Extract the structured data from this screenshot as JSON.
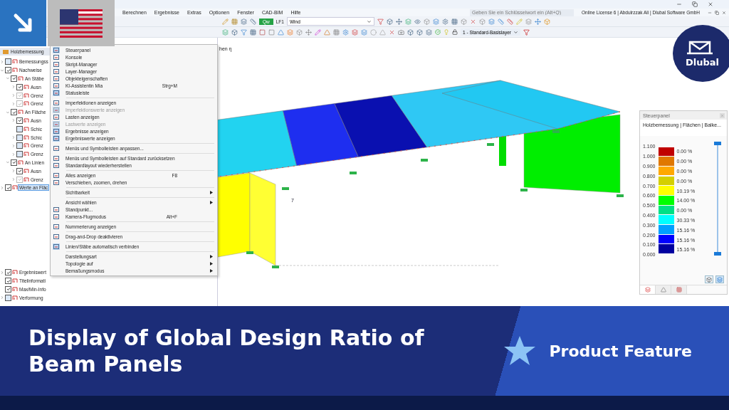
{
  "menu_bar": [
    "Berechnen",
    "Ergebnisse",
    "Extras",
    "Optionen",
    "Fenster",
    "CAD-BIM",
    "Hilfe"
  ],
  "search": {
    "placeholder": "Geben Sie ein Schlüsselwort ein (Alt+Q)"
  },
  "license": "Online License 6 | Abdulrzzak Ali | Dlubal Software GmbH",
  "toolbar": {
    "load_case_type": "Qw",
    "load_case": "LF1",
    "load_case_name": "Wind",
    "layer": "1 - Standard-Basislayer"
  },
  "navigator": {
    "title": "Holzbemessung",
    "items": [
      {
        "label": "Bemessungss",
        "checked": false,
        "selected": false,
        "disabled": false,
        "expanded": false
      },
      {
        "label": "Nachweise",
        "checked": true,
        "selected": false,
        "disabled": false,
        "expanded": true,
        "children": [
          {
            "label": "An Stäbe",
            "checked": true,
            "selected": false,
            "disabled": false,
            "expanded": true,
            "children": [
              {
                "label": "Ausn",
                "checked": true,
                "selected": false,
                "disabled": false,
                "expanded": false
              },
              {
                "label": "Grenz",
                "checked": true,
                "selected": false,
                "disabled": true,
                "expanded": false
              },
              {
                "label": "Grenz",
                "checked": true,
                "selected": false,
                "disabled": true,
                "expanded": false
              }
            ]
          },
          {
            "label": "An Fläche",
            "checked": true,
            "selected": false,
            "disabled": false,
            "expanded": true,
            "children": [
              {
                "label": "Ausn",
                "checked": true,
                "selected": false,
                "disabled": false,
                "expanded": false
              },
              {
                "label": "Schic",
                "checked": false,
                "selected": false,
                "disabled": false
              },
              {
                "label": "Schic",
                "checked": false,
                "selected": false,
                "disabled": false,
                "expanded": false
              },
              {
                "label": "Grenz",
                "checked": false,
                "selected": false,
                "disabled": false,
                "expanded": false
              },
              {
                "label": "Grenz",
                "checked": false,
                "selected": false,
                "disabled": false,
                "expanded": false
              }
            ]
          },
          {
            "label": "An Linien",
            "checked": true,
            "selected": false,
            "disabled": false,
            "expanded": true,
            "children": [
              {
                "label": "Ausn",
                "checked": true,
                "selected": false,
                "disabled": false,
                "expanded": false
              },
              {
                "label": "Grenz",
                "checked": true,
                "selected": false,
                "disabled": true,
                "expanded": false
              }
            ]
          }
        ]
      },
      {
        "label": "Werte an Fläc",
        "checked": true,
        "selected": true,
        "disabled": false,
        "expanded": false
      }
    ],
    "bottom_items": [
      {
        "label": "Ergebniswert",
        "checked": true,
        "selected": false,
        "disabled": false,
        "expanded": false
      },
      {
        "label": "Titelinformati",
        "checked": true,
        "selected": false,
        "disabled": false
      },
      {
        "label": "Max/Min-Info",
        "checked": true,
        "selected": false,
        "disabled": false
      },
      {
        "label": "Verformung",
        "checked": false,
        "selected": false,
        "disabled": false,
        "expanded": false
      }
    ]
  },
  "view_menu": [
    {
      "kind": "command",
      "label": "Steuerpanel",
      "checked": true,
      "disabled": false
    },
    {
      "kind": "command",
      "label": "Konsole",
      "checked": false,
      "disabled": false
    },
    {
      "kind": "command",
      "label": "Skript-Manager",
      "checked": false,
      "disabled": false
    },
    {
      "kind": "command",
      "label": "Layer-Manager",
      "checked": false,
      "disabled": false
    },
    {
      "kind": "command",
      "label": "Objekteigenschaften",
      "checked": false,
      "disabled": false
    },
    {
      "kind": "command",
      "label": "KI-Assistentin Mia",
      "shortcut": "Strg+M",
      "checked": false,
      "disabled": false
    },
    {
      "kind": "command",
      "label": "Statusleiste",
      "checked": true,
      "disabled": false
    },
    {
      "kind": "separator"
    },
    {
      "kind": "command",
      "label": "Imperfektionen anzeigen",
      "checked": false,
      "disabled": false
    },
    {
      "kind": "command",
      "label": "Imperfektionswerte anzeigen",
      "checked": true,
      "disabled": true
    },
    {
      "kind": "command",
      "label": "Lasten anzeigen",
      "checked": false,
      "disabled": false
    },
    {
      "kind": "command",
      "label": "Lastwerte anzeigen",
      "checked": true,
      "disabled": true
    },
    {
      "kind": "command",
      "label": "Ergebnisse anzeigen",
      "checked": true,
      "disabled": false
    },
    {
      "kind": "command",
      "label": "Ergebniswerte anzeigen",
      "checked": true,
      "disabled": false
    },
    {
      "kind": "separator"
    },
    {
      "kind": "command",
      "label": "Menüs und Symbolleisten anpassen...",
      "checked": false,
      "disabled": false
    },
    {
      "kind": "separator"
    },
    {
      "kind": "command",
      "label": "Menüs und Symbolleisten auf Standard zurücksetzen",
      "checked": false,
      "disabled": false
    },
    {
      "kind": "command",
      "label": "Standardlayout wiederherstellen",
      "checked": false,
      "disabled": false
    },
    {
      "kind": "separator"
    },
    {
      "kind": "command",
      "label": "Alles anzeigen",
      "shortcut": "F8",
      "checked": false,
      "disabled": false
    },
    {
      "kind": "command",
      "label": "Verschieben, zoomen, drehen",
      "checked": false,
      "disabled": false
    },
    {
      "kind": "separator"
    },
    {
      "kind": "submenu",
      "label": "Sichtbarkeit"
    },
    {
      "kind": "separator"
    },
    {
      "kind": "submenu",
      "label": "Ansicht wählen"
    },
    {
      "kind": "command",
      "label": "Standpunkt...",
      "checked": false,
      "disabled": false
    },
    {
      "kind": "command",
      "label": "Kamera-Flugmodus",
      "shortcut": "Alt+F",
      "checked": false,
      "disabled": false
    },
    {
      "kind": "separator"
    },
    {
      "kind": "command",
      "label": "Nummerierung anzeigen",
      "checked": false,
      "disabled": false
    },
    {
      "kind": "separator"
    },
    {
      "kind": "command",
      "label": "Drag-and-Drop deaktivieren",
      "checked": false,
      "disabled": false
    },
    {
      "kind": "separator"
    },
    {
      "kind": "command",
      "label": "Linien/Stäbe automatisch verbinden",
      "checked": true,
      "disabled": false
    },
    {
      "kind": "separator"
    },
    {
      "kind": "submenu",
      "label": "Darstellungsart"
    },
    {
      "kind": "submenu",
      "label": "Topologie auf"
    },
    {
      "kind": "submenu",
      "label": "Bemaßungsmodus"
    }
  ],
  "viewport": {
    "heading": "hen η",
    "node_label": "7"
  },
  "control_panel": {
    "title": "Steuerpanel",
    "subtitle": "Holzbemessung | Flächen | Balke...",
    "legend": [
      {
        "value": "1.100",
        "color": "#c00000",
        "percent": "0.00 %"
      },
      {
        "value": "1.000",
        "color": "#e07800",
        "percent": "0.00 %"
      },
      {
        "value": "0.900",
        "color": "#ffa800",
        "percent": "0.00 %"
      },
      {
        "value": "0.800",
        "color": "#d4cf00",
        "percent": "0.00 %"
      },
      {
        "value": "0.700",
        "color": "#ffff00",
        "percent": "10.19 %"
      },
      {
        "value": "0.600",
        "color": "#00ff00",
        "percent": "14.00 %"
      },
      {
        "value": "0.500",
        "color": "#00e085",
        "percent": "0.00 %"
      },
      {
        "value": "0.400",
        "color": "#00ffff",
        "percent": "30.33 %"
      },
      {
        "value": "0.300",
        "color": "#00a0ff",
        "percent": "15.16 %"
      },
      {
        "value": "0.200",
        "color": "#0000ff",
        "percent": "15.16 %"
      },
      {
        "value": "0.100",
        "color": "#0000a0",
        "percent": "15.16 %"
      }
    ],
    "last_value": "0.000",
    "range_slider": {
      "level": 1
    },
    "tabs": [
      {
        "selected": true
      },
      {
        "selected": false
      },
      {
        "selected": false
      }
    ]
  },
  "banner": {
    "title": "Display of Global Design Ratio of Beam Panels",
    "tag": "Product Feature"
  },
  "logo": {
    "text": "Dlubal"
  }
}
